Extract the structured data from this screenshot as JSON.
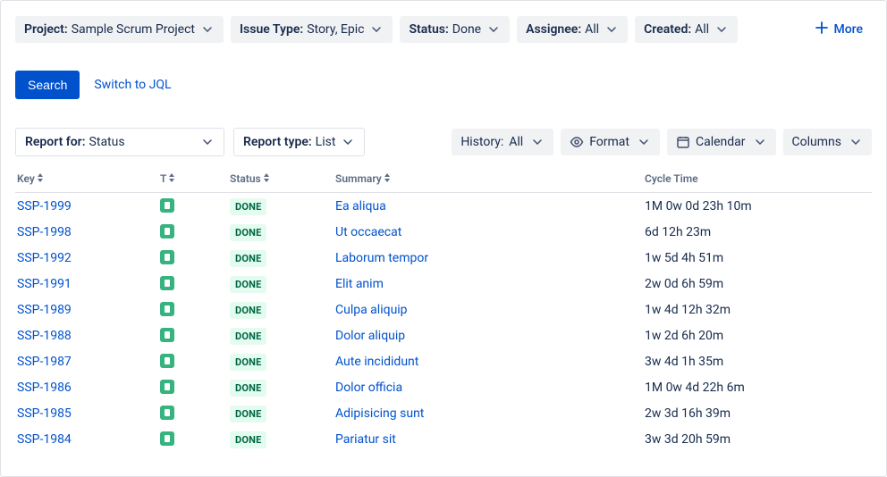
{
  "filters": {
    "project": {
      "label": "Project:",
      "value": "Sample Scrum Project"
    },
    "issueType": {
      "label": "Issue Type:",
      "value": "Story, Epic"
    },
    "status": {
      "label": "Status:",
      "value": "Done"
    },
    "assignee": {
      "label": "Assignee:",
      "value": "All"
    },
    "created": {
      "label": "Created:",
      "value": "All"
    },
    "more": "More"
  },
  "actions": {
    "search": "Search",
    "switchJql": "Switch to JQL"
  },
  "report": {
    "reportFor": {
      "label": "Report for:",
      "value": "Status"
    },
    "reportType": {
      "label": "Report type:",
      "value": "List"
    }
  },
  "toolbar": {
    "history": {
      "label": "History:",
      "value": "All"
    },
    "format": "Format",
    "calendar": "Calendar",
    "columns": "Columns"
  },
  "columns": {
    "key": "Key",
    "type": "T",
    "status": "Status",
    "summary": "Summary",
    "cycleTime": "Cycle Time"
  },
  "statusBadge": "DONE",
  "rows": [
    {
      "key": "SSP-1999",
      "summary": "Ea aliqua",
      "cycle": "1M 0w 0d 23h 10m"
    },
    {
      "key": "SSP-1998",
      "summary": "Ut occaecat",
      "cycle": "6d 12h 23m"
    },
    {
      "key": "SSP-1992",
      "summary": "Laborum tempor",
      "cycle": "1w 5d 4h 51m"
    },
    {
      "key": "SSP-1991",
      "summary": "Elit anim",
      "cycle": "2w 0d 6h 59m"
    },
    {
      "key": "SSP-1989",
      "summary": "Culpa aliquip",
      "cycle": "1w 4d 12h 32m"
    },
    {
      "key": "SSP-1988",
      "summary": "Dolor aliquip",
      "cycle": "1w 2d 6h 20m"
    },
    {
      "key": "SSP-1987",
      "summary": "Aute incididunt",
      "cycle": "3w 4d 1h 35m"
    },
    {
      "key": "SSP-1986",
      "summary": "Dolor officia",
      "cycle": "1M 0w 4d 22h 6m"
    },
    {
      "key": "SSP-1985",
      "summary": "Adipisicing sunt",
      "cycle": "2w 3d 16h 39m"
    },
    {
      "key": "SSP-1984",
      "summary": "Pariatur sit",
      "cycle": "3w 3d 20h 59m"
    }
  ]
}
